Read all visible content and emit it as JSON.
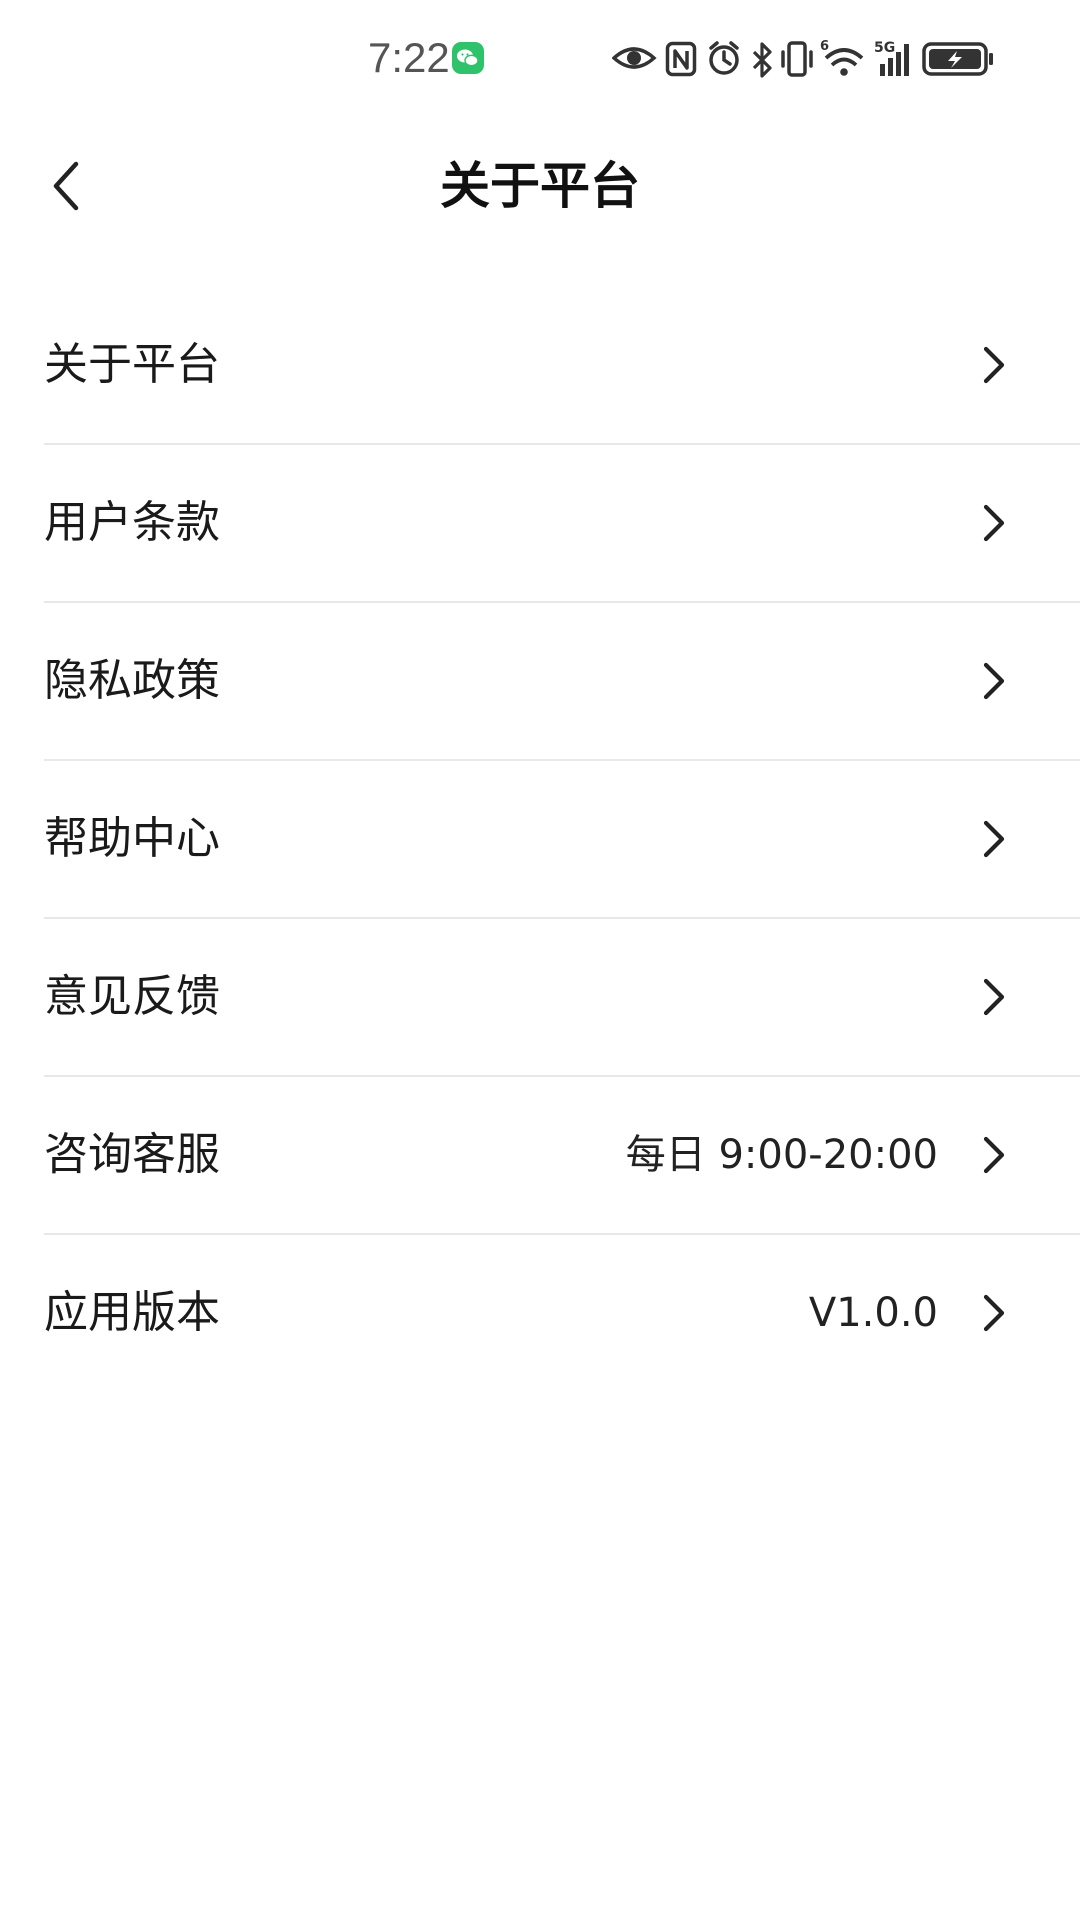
{
  "status_bar": {
    "time": "7:22",
    "icons": [
      "wechat-icon",
      "eye-icon",
      "nfc-icon",
      "alarm-icon",
      "bluetooth-icon",
      "vibrate-icon",
      "wifi-icon",
      "signal-5g-icon",
      "battery-charging-icon"
    ],
    "network_label": "5G"
  },
  "nav": {
    "title": "关于平台",
    "back_icon": "chevron-left-icon"
  },
  "menu": {
    "items": [
      {
        "label": "关于平台",
        "value": ""
      },
      {
        "label": "用户条款",
        "value": ""
      },
      {
        "label": "隐私政策",
        "value": ""
      },
      {
        "label": "帮助中心",
        "value": ""
      },
      {
        "label": "意见反馈",
        "value": ""
      },
      {
        "label": "咨询客服",
        "value": "每日 9:00-20:00"
      },
      {
        "label": "应用版本",
        "value": "V1.0.0"
      }
    ]
  },
  "colors": {
    "background": "#ffffff",
    "divider": "#e8e8e8",
    "wechat_green": "#2ec26a",
    "text": "#1a1a1a"
  }
}
